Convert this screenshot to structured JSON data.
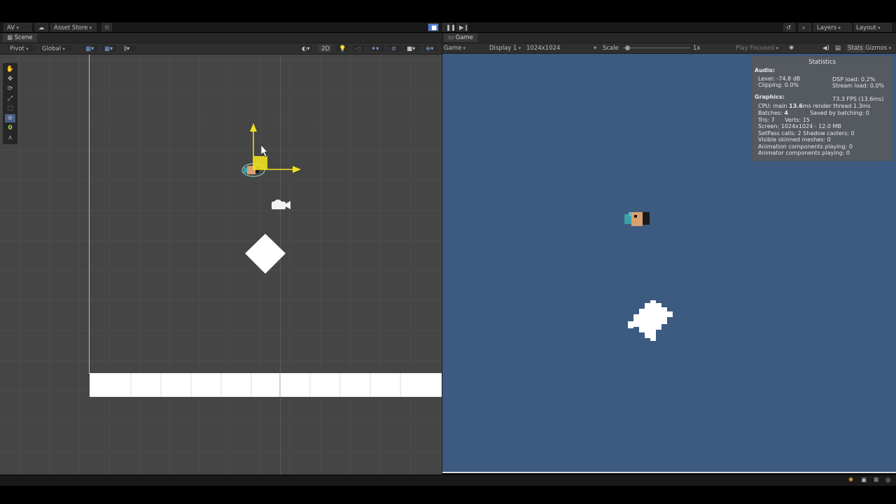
{
  "toolbar": {
    "account": "AV",
    "asset_store": "Asset Store",
    "layers": "Layers",
    "layout": "Layout"
  },
  "scene": {
    "tab": "Scene",
    "pivot": "Pivot",
    "global": "Global",
    "mode_2d": "2D",
    "tool_counter": "0"
  },
  "game": {
    "tab": "Game",
    "view": "Game",
    "display": "Display 1",
    "resolution": "1024x1024",
    "scale_label": "Scale",
    "scale_value": "1x",
    "play_mode": "Play Focused",
    "stats": "Stats",
    "gizmos": "Gizmos"
  },
  "statistics": {
    "title": "Statistics",
    "audio_header": "Audio:",
    "level": "Level: -74.8 dB",
    "clipping": "Clipping: 0.0%",
    "dsp": "DSP load: 0.2%",
    "stream": "Stream load: 0.0%",
    "graphics_header": "Graphics:",
    "fps": "73.3 FPS (13.6ms)",
    "cpu_prefix": "CPU: main ",
    "cpu_main": "13.6",
    "cpu_suffix": "ms  render thread 1.3ms",
    "batches_prefix": "Batches: ",
    "batches": "4",
    "saved": "Saved by batching: 0",
    "tris": "Tris: 7",
    "verts": "Verts: 15",
    "screen": "Screen: 1024x1024 - 12.0 MB",
    "setpass": "SetPass calls: 2  Shadow casters: 0",
    "skinned": "Visible skinned meshes: 0",
    "animation": "Animation components playing: 0",
    "animator": "Animator components playing: 0"
  },
  "colors": {
    "game_bg": "#3d5a80",
    "scene_bg": "#454545",
    "gizmo_yellow": "#f0e020",
    "play_blue": "#4c7ad1",
    "counter_green": "#9be04a"
  }
}
